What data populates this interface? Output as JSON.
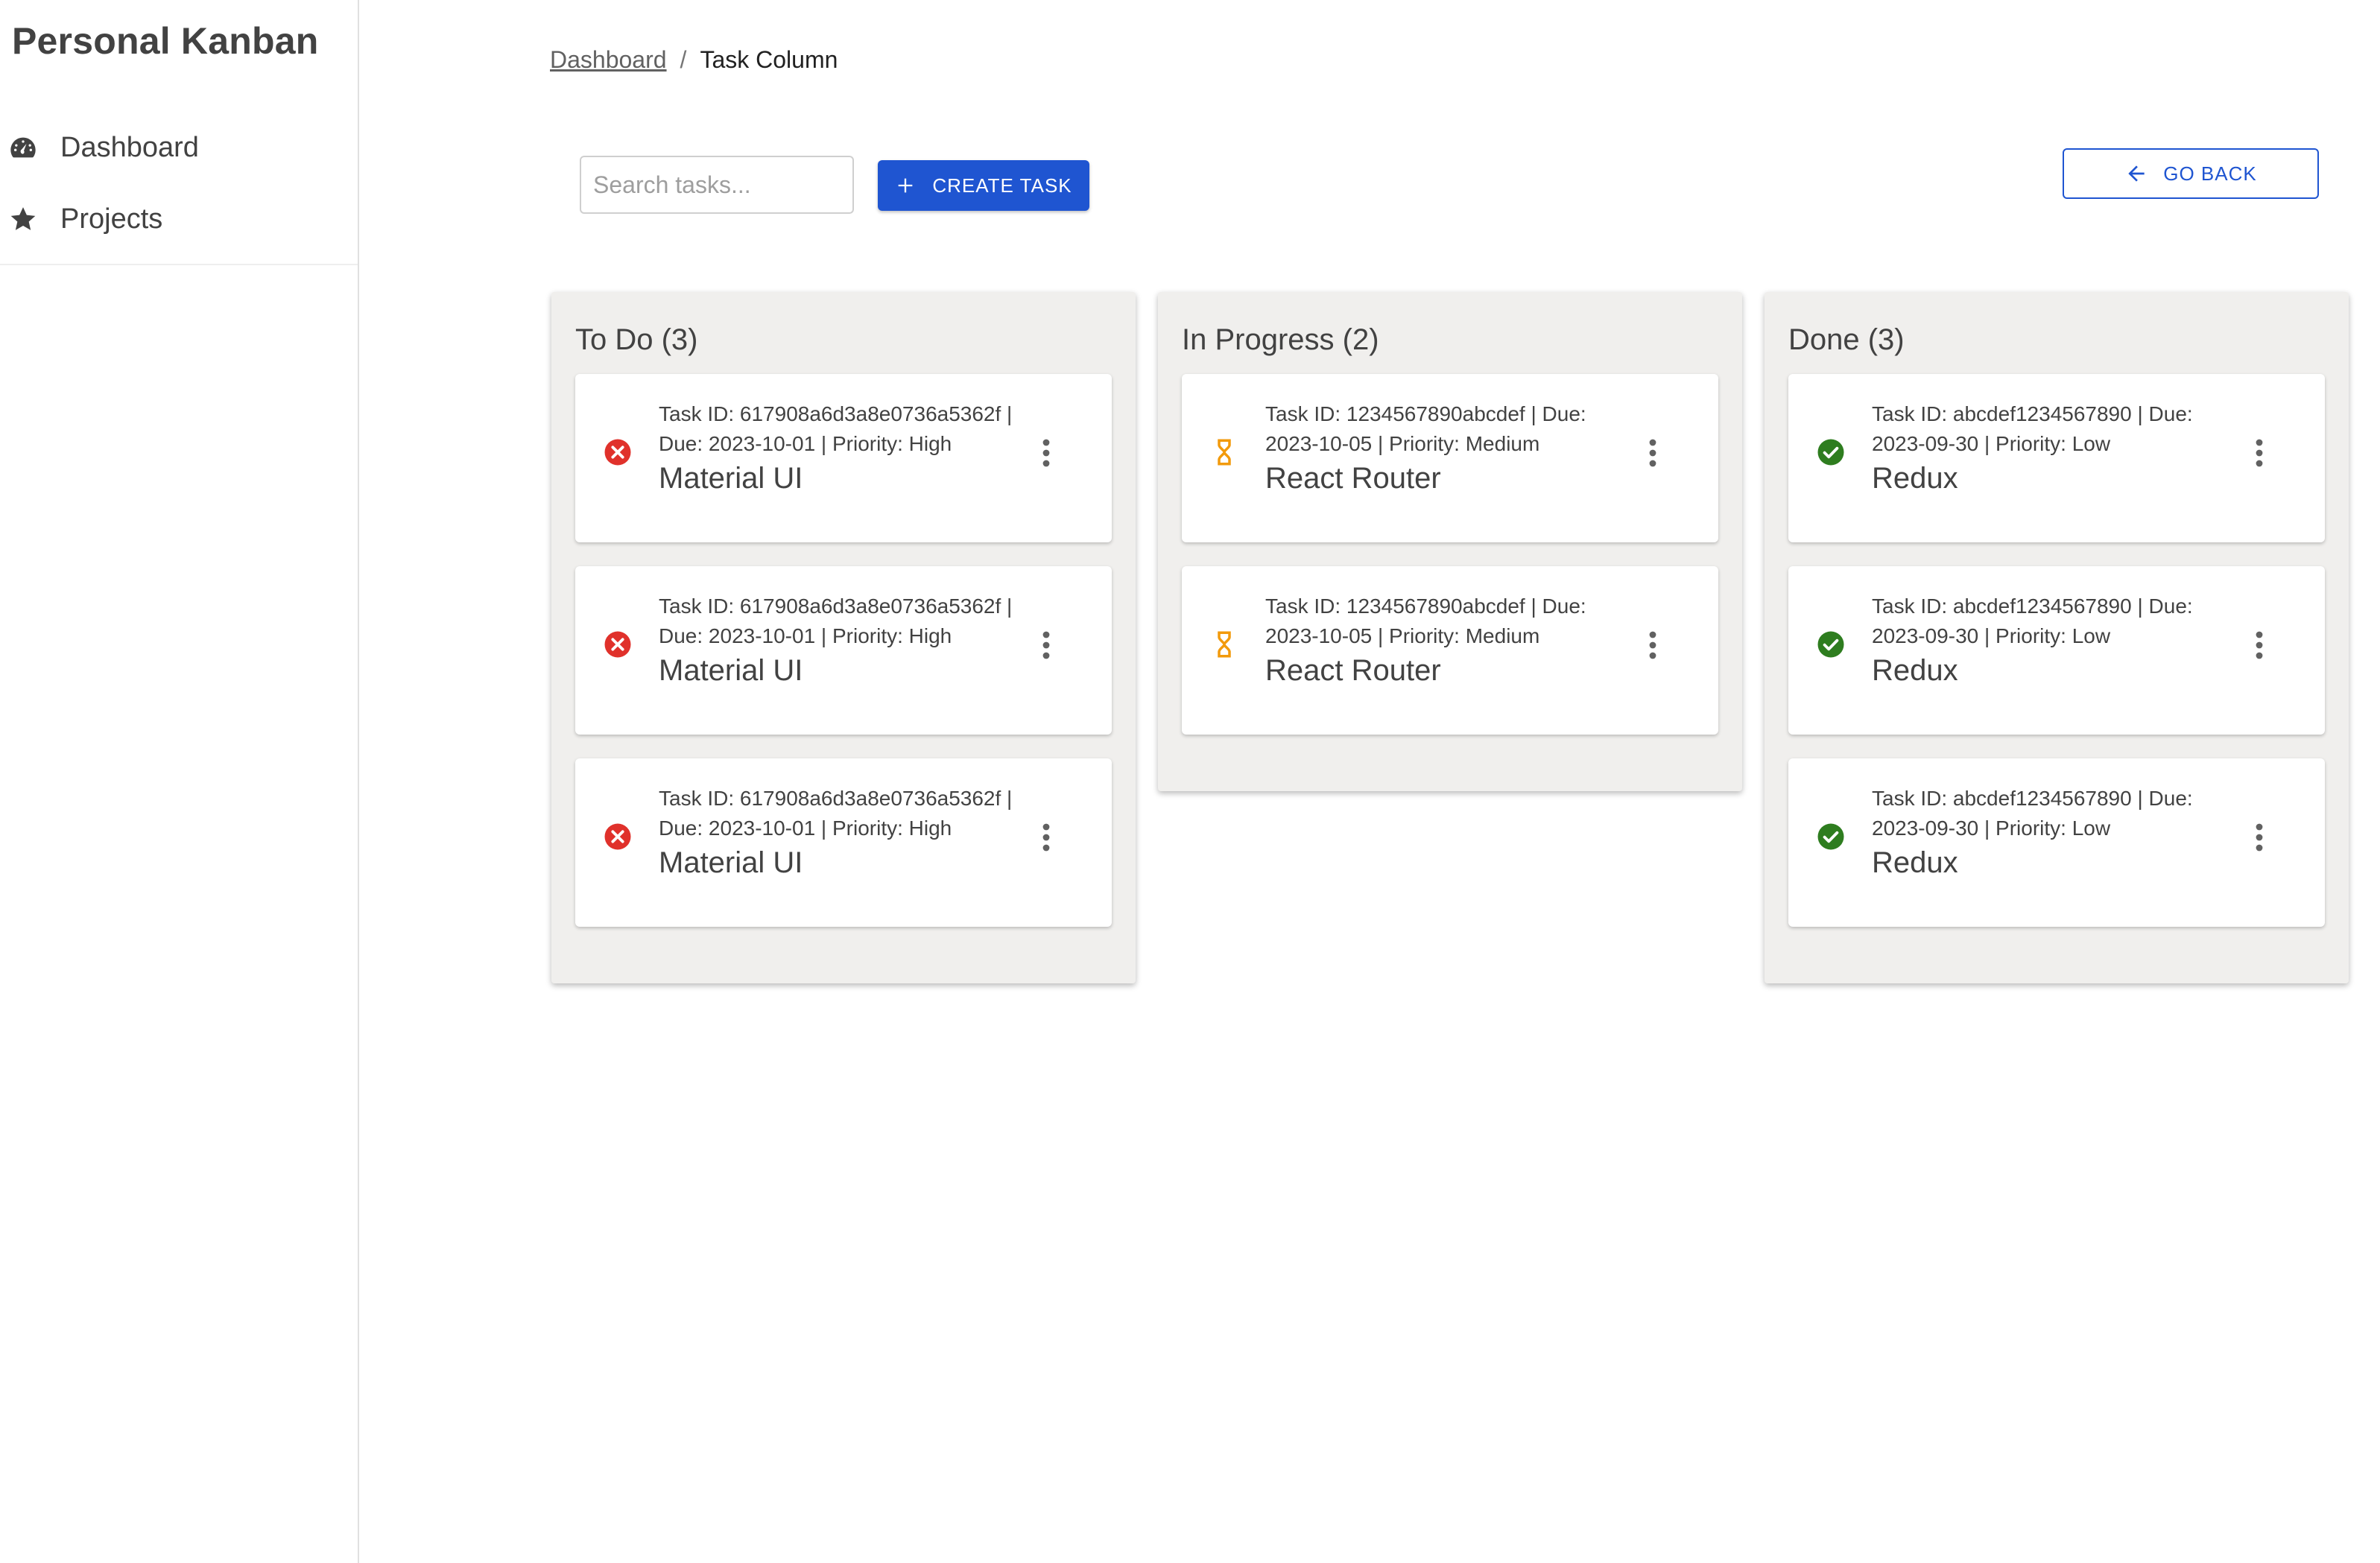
{
  "app": {
    "title": "Personal Kanban"
  },
  "sidebar": {
    "items": [
      {
        "label": "Dashboard",
        "icon": "speedometer-icon"
      },
      {
        "label": "Projects",
        "icon": "star-icon"
      }
    ]
  },
  "breadcrumb": {
    "parent": "Dashboard",
    "separator": "/",
    "current": "Task Column"
  },
  "toolbar": {
    "search_placeholder": "Search tasks...",
    "search_value": "",
    "create_label": "CREATE TASK",
    "back_label": "GO BACK"
  },
  "colors": {
    "primary": "#1f55d1",
    "status_error": "#e0312b",
    "status_pending": "#f29a0c",
    "status_done": "#2e7d1f",
    "column_bg": "#f0efed"
  },
  "columns": [
    {
      "title": "To Do (3)",
      "tasks": [
        {
          "status_icon": "cancel-icon",
          "meta": "Task ID: 617908a6d3a8e0736a5362f | Due: 2023-10-01 | Priority: High",
          "title": "Material UI"
        },
        {
          "status_icon": "cancel-icon",
          "meta": "Task ID: 617908a6d3a8e0736a5362f | Due: 2023-10-01 | Priority: High",
          "title": "Material UI"
        },
        {
          "status_icon": "cancel-icon",
          "meta": "Task ID: 617908a6d3a8e0736a5362f | Due: 2023-10-01 | Priority: High",
          "title": "Material UI"
        }
      ]
    },
    {
      "title": "In Progress (2)",
      "tasks": [
        {
          "status_icon": "hourglass-icon",
          "meta": "Task ID: 1234567890abcdef | Due: 2023-10-05 | Priority: Medium",
          "title": "React Router"
        },
        {
          "status_icon": "hourglass-icon",
          "meta": "Task ID: 1234567890abcdef | Due: 2023-10-05 | Priority: Medium",
          "title": "React Router"
        }
      ]
    },
    {
      "title": "Done (3)",
      "tasks": [
        {
          "status_icon": "check-circle-icon",
          "meta": "Task ID: abcdef1234567890 | Due: 2023-09-30 | Priority: Low",
          "title": "Redux"
        },
        {
          "status_icon": "check-circle-icon",
          "meta": "Task ID: abcdef1234567890 | Due: 2023-09-30 | Priority: Low",
          "title": "Redux"
        },
        {
          "status_icon": "check-circle-icon",
          "meta": "Task ID: abcdef1234567890 | Due: 2023-09-30 | Priority: Low",
          "title": "Redux"
        }
      ]
    }
  ]
}
